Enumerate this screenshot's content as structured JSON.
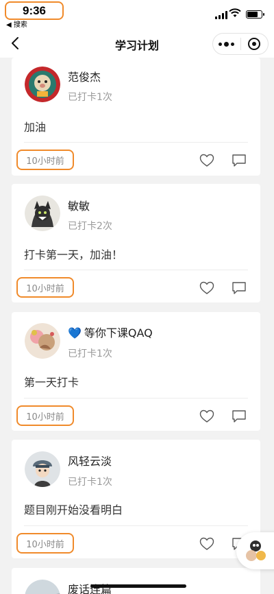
{
  "status_bar": {
    "time": "9:36",
    "back_app": "◀ 搜索"
  },
  "nav": {
    "title": "学习计划"
  },
  "icons": {
    "back": "chevron-left-icon",
    "more": "more-dots-icon",
    "target": "target-icon",
    "like": "heart-outline-icon",
    "comment": "comment-icon"
  },
  "accent_color": "#f08a2a",
  "posts": [
    {
      "name": "范俊杰",
      "checkin": "已打卡1次",
      "content": "加油",
      "time": "10小时前"
    },
    {
      "name": "敏敏",
      "checkin": "已打卡2次",
      "content": "打卡第一天，加油！",
      "time": "10小时前"
    },
    {
      "emoji": "💙",
      "name": "等你下课QAQ",
      "checkin": "已打卡1次",
      "content": "第一天打卡",
      "time": "10小时前"
    },
    {
      "name": "风轻云淡",
      "checkin": "已打卡1次",
      "content": "题目刚开始没看明白",
      "time": "10小时前"
    },
    {
      "name": "废话连篇"
    }
  ]
}
